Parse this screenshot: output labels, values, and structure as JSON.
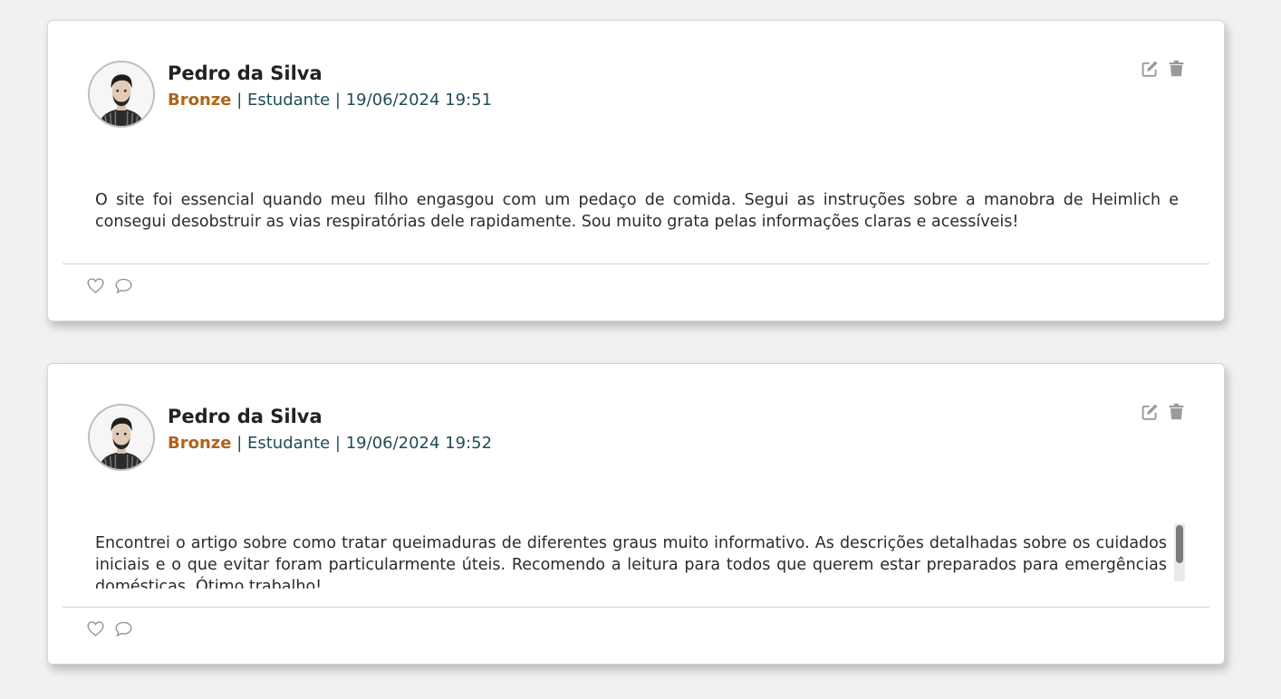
{
  "posts": [
    {
      "author": "Pedro da Silva",
      "rank": "Bronze",
      "role": "Estudante",
      "datetime": "19/06/2024 19:51",
      "separator": " | ",
      "text": "O site foi essencial quando meu filho engasgou com um pedaço de comida. Segui as instruções sobre a manobra de Heimlich e consegui desobstruir as vias respiratórias dele rapidamente. Sou muito grata pelas informações claras e acessíveis!"
    },
    {
      "author": "Pedro da Silva",
      "rank": "Bronze",
      "role": "Estudante",
      "datetime": "19/06/2024 19:52",
      "separator": " | ",
      "text": "Encontrei o artigo sobre como tratar queimaduras de diferentes graus muito informativo. As descrições detalhadas sobre os cuidados iniciais e o que evitar foram particularmente úteis. Recomendo a leitura para todos que querem estar preparados para emergências domésticas. Ótimo trabalho!"
    }
  ],
  "colors": {
    "rank_bronze": "#b0641a",
    "meta_text": "#1f4d57",
    "icon_gray": "#9a9a9a",
    "background": "#f0f2f1"
  },
  "icons": {
    "edit": "edit-icon",
    "delete": "trash-icon",
    "like": "heart-icon",
    "comment": "comment-icon"
  }
}
